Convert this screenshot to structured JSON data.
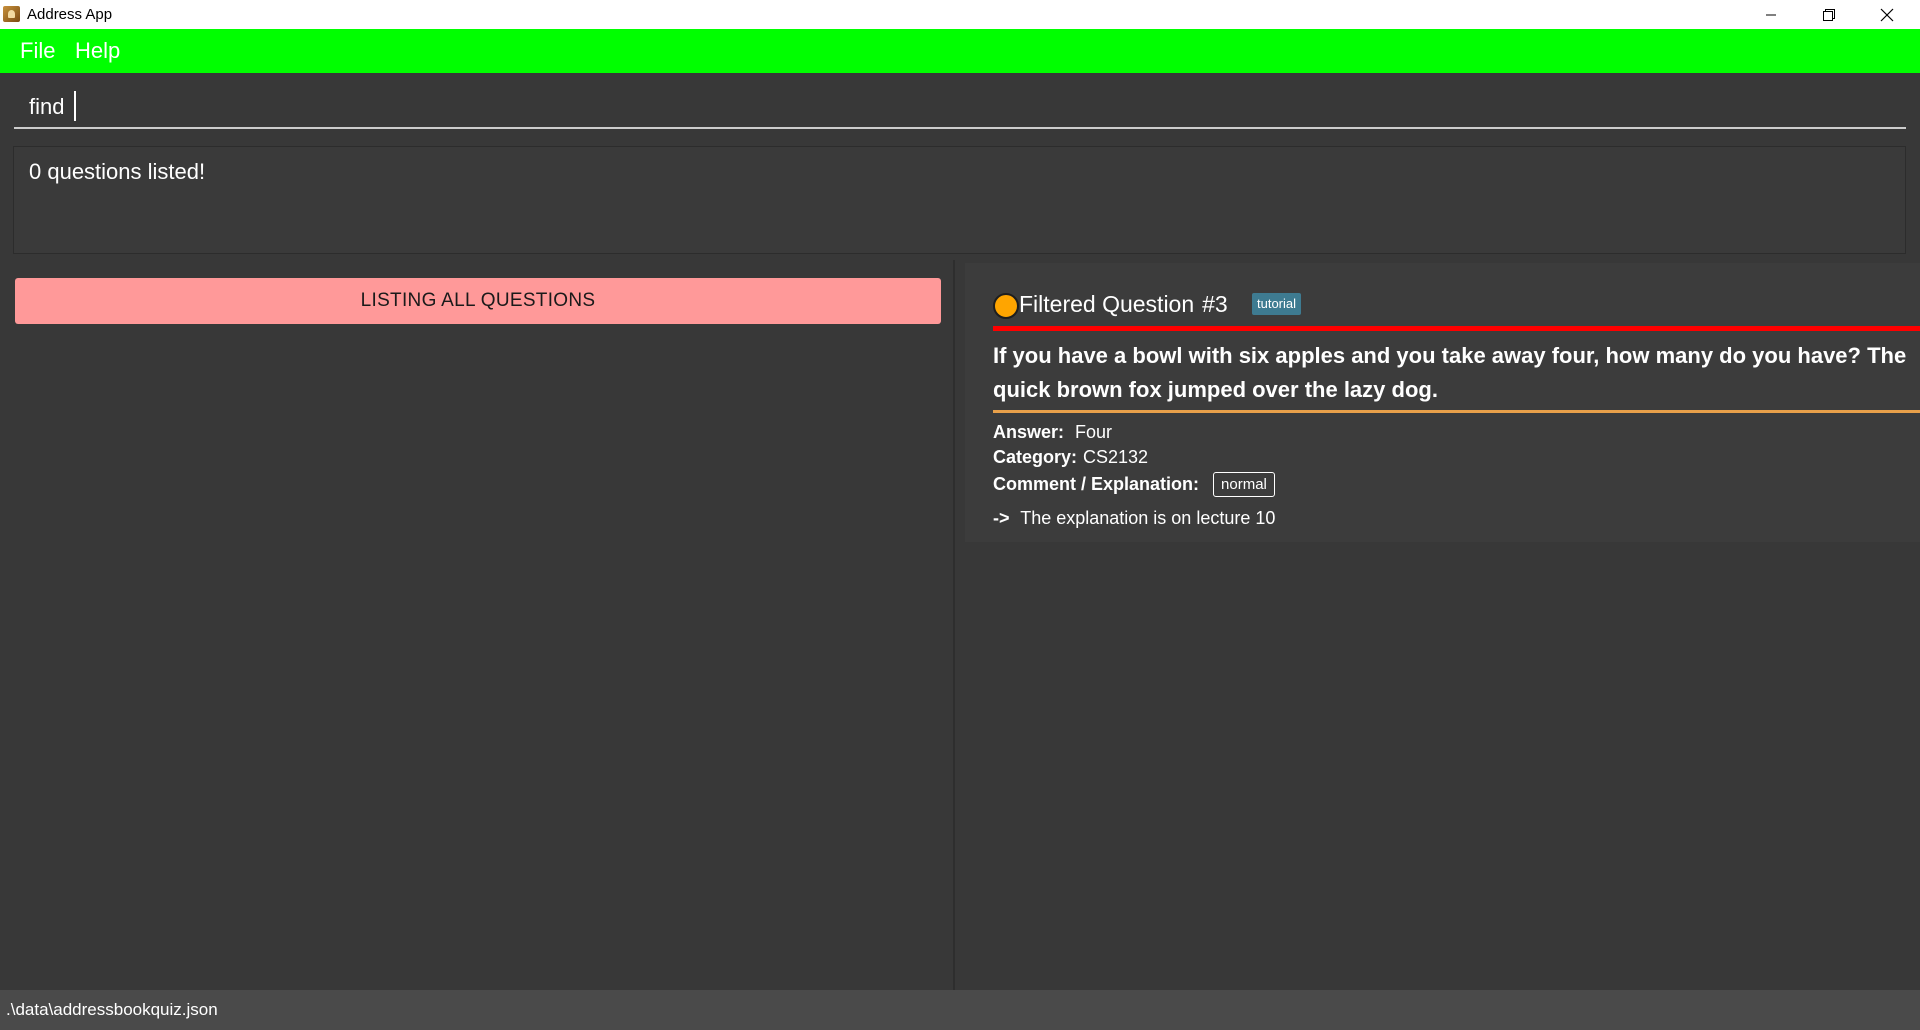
{
  "window": {
    "title": "Address App"
  },
  "menu": {
    "items": [
      {
        "label": "File"
      },
      {
        "label": "Help"
      }
    ]
  },
  "command": {
    "value": "find "
  },
  "result": {
    "message": "0 questions listed!"
  },
  "list_panel": {
    "button_label": "LISTING ALL QUESTIONS"
  },
  "question_card": {
    "title": "Filtered Question",
    "number": "#3",
    "tag": "tutorial",
    "question": "If you have a bowl with six apples and you take away four, how many do you have? The quick brown fox jumped over the lazy dog.",
    "answer_label": "Answer:",
    "answer": "Four",
    "category_label": "Category:",
    "category": "CS2132",
    "comment_label": "Comment / Explanation:",
    "comment_tag": "normal",
    "explanation_arrow": "->",
    "explanation": "The explanation is on lecture 10",
    "status_color": "#ffa500"
  },
  "status_bar": {
    "path": ".\\data\\addressbookquiz.json"
  },
  "colors": {
    "menubar": "#00ff00",
    "background": "#383838",
    "listing_button": "#ff9999",
    "tag": "#3e7b91",
    "divider_red": "#ff0000",
    "divider_orange": "#e8a04a"
  }
}
